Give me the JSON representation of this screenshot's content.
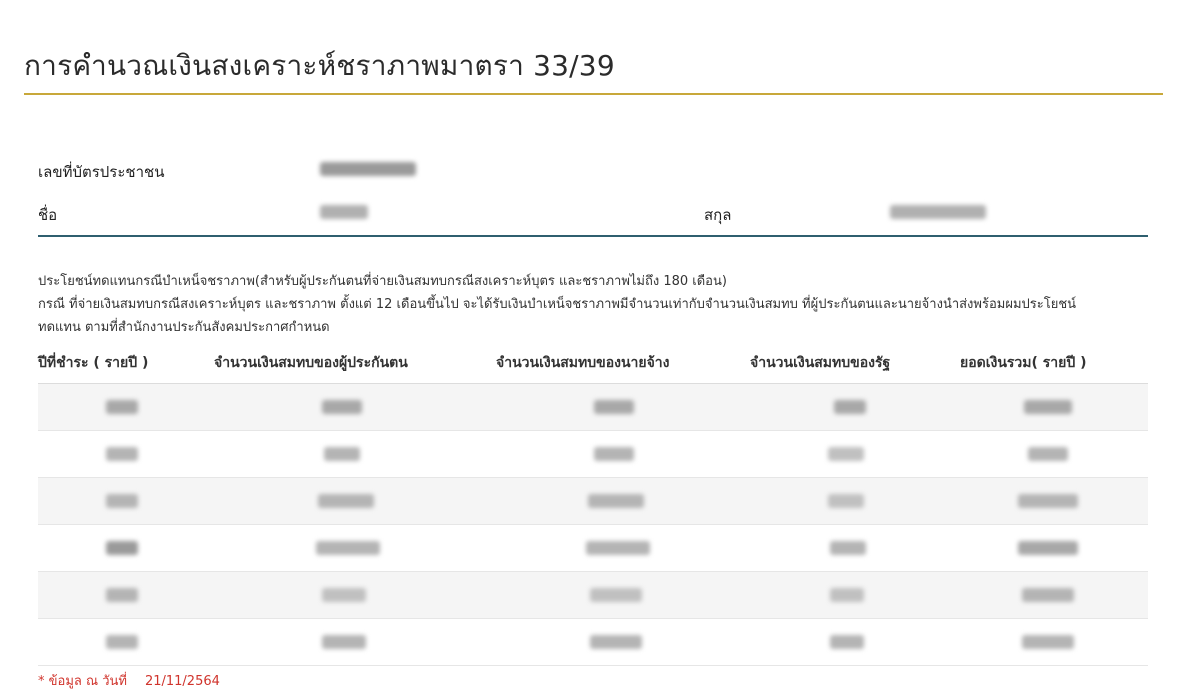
{
  "page": {
    "title": "การคำนวณเงินสงเคราะห์ชราภาพมาตรา 33/39"
  },
  "info": {
    "id_label": "เลขที่บัตรประชาชน",
    "name_label": "ชื่อ",
    "surname_label": "สกุล"
  },
  "description": {
    "line1": "ประโยชน์ทดแทนกรณีบำเหน็จชราภาพ(สำหรับผู้ประกันตนที่จ่ายเงินสมทบกรณีสงเคราะห์บุตร และชราภาพไม่ถึง 180 เดือน)",
    "line2": "กรณี ที่จ่ายเงินสมทบกรณีสงเคราะห์บุตร และชราภาพ ตั้งแต่ 12 เดือนขึ้นไป จะได้รับเงินบำเหน็จชราภาพมีจำนวนเท่ากับจำนวนเงินสมทบ ที่ผู้ประกันตนและนายจ้างนำส่งพร้อมผมประโยชน์",
    "line3": "ทดแทน ตามที่สำนักงานประกันสังคมประกาศกำหนด"
  },
  "table": {
    "headers": [
      "ปีที่ชำระ ( รายปี )",
      "จำนวนเงินสมทบของผู้ประกันตน",
      "จำนวนเงินสมทบของนายจ้าง",
      "จำนวนเงินสมทบของรัฐ",
      "ยอดเงินรวม( รายปี )"
    ]
  },
  "footnote": {
    "label": "* ข้อมูล  ณ  วันที่",
    "date": "21/11/2564"
  },
  "colors": {
    "accent_rule": "#c8a83a",
    "info_rule": "#2f5f6f",
    "footnote": "#d0342c"
  }
}
